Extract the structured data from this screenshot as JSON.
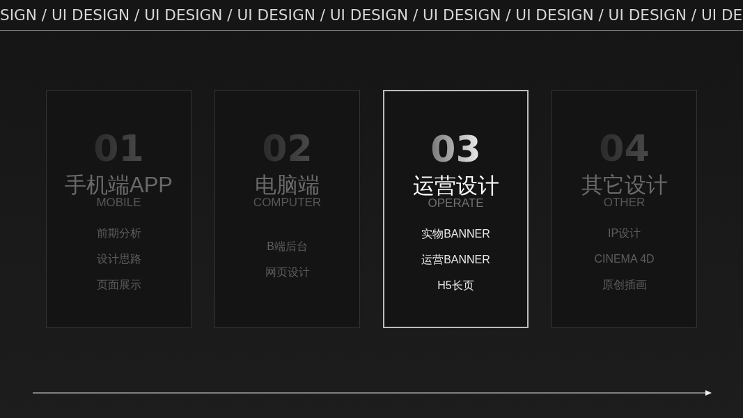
{
  "marquee": "SIGN / UI DESIGN / UI DESIGN / UI DESIGN / UI DESIGN / UI DESIGN / UI DESIGN / UI DESIGN / UI DE",
  "cards": [
    {
      "number": "01",
      "title": "手机端APP",
      "subtitle": "MOBILE",
      "items": [
        "前期分析",
        "设计思路",
        "页面展示"
      ],
      "selected": false
    },
    {
      "number": "02",
      "title": "电脑端",
      "subtitle": "COMPUTER",
      "items": [
        "B端后台",
        "网页设计"
      ],
      "selected": false
    },
    {
      "number": "03",
      "title": "运营设计",
      "subtitle": "OPERATE",
      "items": [
        "实物BANNER",
        "运营BANNER",
        "H5长页"
      ],
      "selected": true
    },
    {
      "number": "04",
      "title": "其它设计",
      "subtitle": "OTHER",
      "items": [
        "IP设计",
        "CINEMA 4D",
        "原创插画"
      ],
      "selected": false
    }
  ]
}
